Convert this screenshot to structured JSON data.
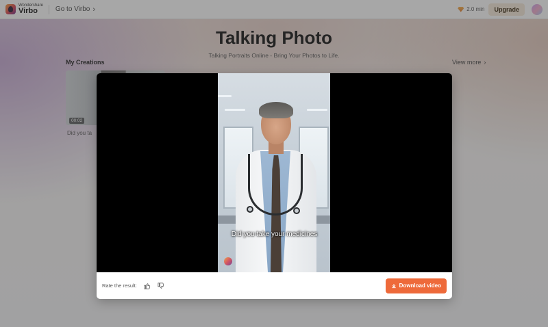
{
  "topbar": {
    "logo_brand": "Wondershare",
    "logo_product": "Virbo",
    "goto_label": "Go to Virbo",
    "credit": "2.0 min",
    "upgrade_label": "Upgrade"
  },
  "hero": {
    "title": "Talking Photo",
    "subtitle": "Talking Portraits Online - Bring Your Photos to Life."
  },
  "creations": {
    "title": "My Creations",
    "view_more": "View more",
    "items": [
      {
        "duration": "00:02",
        "caption": "Did you ta"
      }
    ]
  },
  "modal": {
    "video_subtitle": "Did you take your medicines",
    "rate_label": "Rate the result:",
    "download_label": "Download video"
  },
  "colors": {
    "accent": "#ee6a3a",
    "upgrade_bg": "#f6ead9"
  }
}
